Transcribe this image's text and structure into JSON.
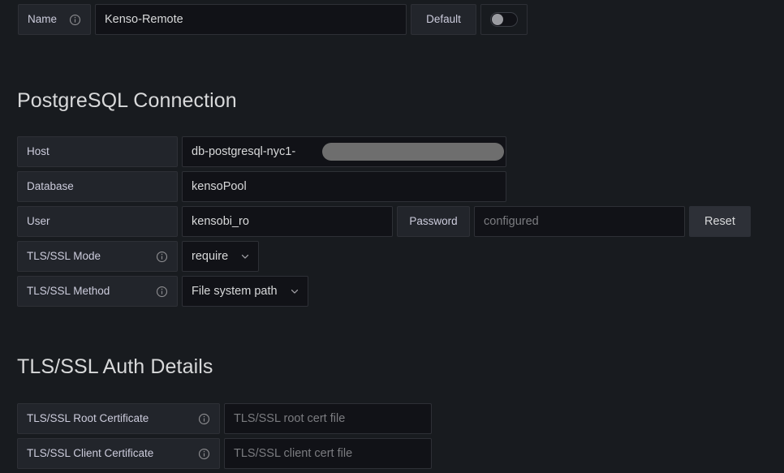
{
  "name_row": {
    "label": "Name",
    "info_icon": "info-circle-icon",
    "value": "Kenso-Remote",
    "default_label": "Default",
    "default_toggle_on": false
  },
  "postgres_section": {
    "heading": "PostgreSQL Connection",
    "fields": {
      "host": {
        "label": "Host",
        "value": "db-postgresql-nyc1-",
        "redacted": true
      },
      "database": {
        "label": "Database",
        "value": "kensoPool"
      },
      "user": {
        "label": "User",
        "value": "kensobi_ro"
      },
      "password": {
        "label": "Password",
        "placeholder": "configured",
        "reset_label": "Reset"
      },
      "tls_mode": {
        "label": "TLS/SSL Mode",
        "info_icon": "info-circle-icon",
        "value": "require",
        "chevron": "chevron-down-icon"
      },
      "tls_method": {
        "label": "TLS/SSL Method",
        "info_icon": "info-circle-icon",
        "value": "File system path",
        "chevron": "chevron-down-icon"
      }
    }
  },
  "tls_section": {
    "heading": "TLS/SSL Auth Details",
    "fields": {
      "root_cert": {
        "label": "TLS/SSL Root Certificate",
        "info_icon": "info-circle-icon",
        "placeholder": "TLS/SSL root cert file",
        "value": ""
      },
      "client_cert": {
        "label": "TLS/SSL Client Certificate",
        "info_icon": "info-circle-icon",
        "placeholder": "TLS/SSL client cert file",
        "value": ""
      }
    }
  },
  "colors": {
    "page_background": "#181b1f",
    "label_background": "#22252b",
    "input_background": "#111217",
    "border": "#2e3036",
    "text": "#ccccdc",
    "placeholder_text": "#7b7c80",
    "button_secondary": "#2d3037",
    "redaction": "#6e6e6e"
  }
}
